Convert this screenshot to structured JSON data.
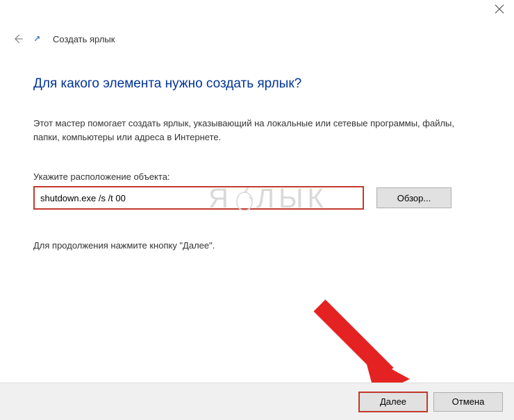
{
  "titlebar": {
    "close_tooltip": "Close"
  },
  "header": {
    "wizard_title": "Создать ярлык"
  },
  "content": {
    "heading": "Для какого элемента нужно создать ярлык?",
    "description": "Этот мастер помогает создать ярлык, указывающий на локальные или сетевые программы, файлы, папки, компьютеры или адреса в Интернете.",
    "field_label": "Укажите расположение объекта:",
    "path_value": "shutdown.exe /s /t 00",
    "browse_label": "Обзор...",
    "continue_text": "Для продолжения нажмите кнопку \"Далее\"."
  },
  "footer": {
    "next_label": "Далее",
    "cancel_label": "Отмена"
  },
  "watermark": {
    "text_left": "Я",
    "text_right": "ЛЫК"
  }
}
